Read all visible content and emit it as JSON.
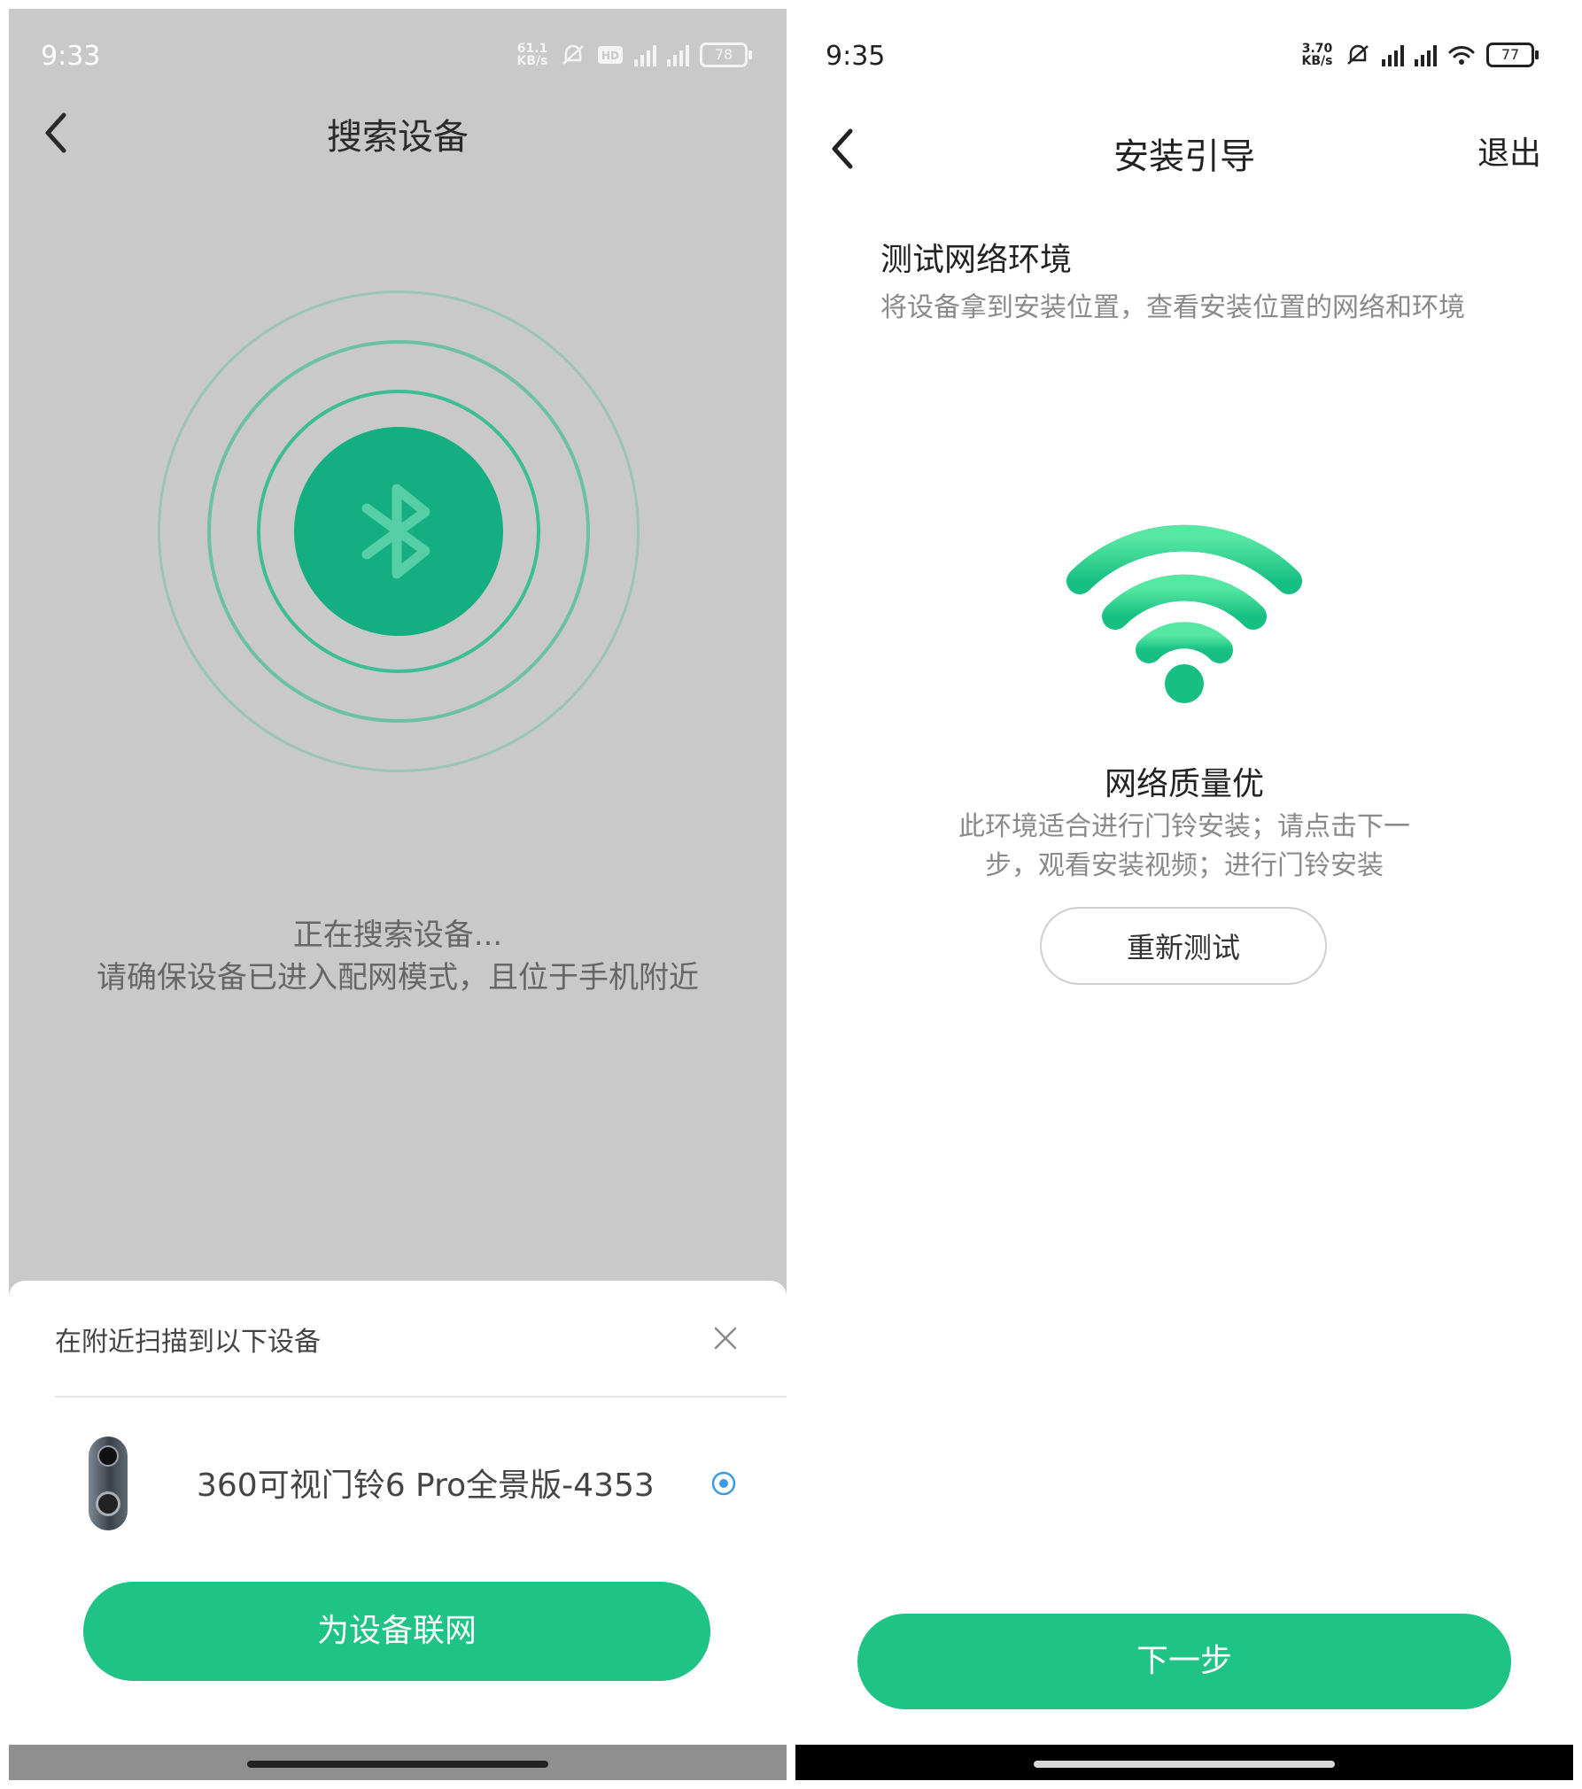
{
  "left_screen": {
    "status": {
      "time": "9:33",
      "net_speed": "61.1 KB/s",
      "battery": "78"
    },
    "title": "搜索设备",
    "searching_line1": "正在搜索设备...",
    "searching_line2": "请确保设备已进入配网模式，且位于手机附近",
    "sheet": {
      "title": "在附近扫描到以下设备",
      "device_name": "360可视门铃6 Pro全景版-4353",
      "button_label": "为设备联网"
    }
  },
  "right_screen": {
    "status": {
      "time": "9:35",
      "net_speed": "3.70 KB/s",
      "battery": "77"
    },
    "title": "安装引导",
    "exit_label": "退出",
    "section_title": "测试网络环境",
    "section_subtitle": "将设备拿到安装位置，查看安装位置的网络和环境",
    "quality_title": "网络质量优",
    "quality_desc": "此环境适合进行门铃安装；请点击下一步，观看安装视频；进行门铃安装",
    "retest_label": "重新测试",
    "next_label": "下一步"
  },
  "colors": {
    "accent": "#1ec385",
    "bluetooth_core": "#14ae80",
    "wifi_light": "#4fe49d",
    "wifi_dark": "#1ec385"
  },
  "icons": [
    "back-icon",
    "bluetooth-icon",
    "close-icon",
    "radio-selected-icon",
    "wifi-icon",
    "mute-icon",
    "signal-icon",
    "battery-icon"
  ]
}
